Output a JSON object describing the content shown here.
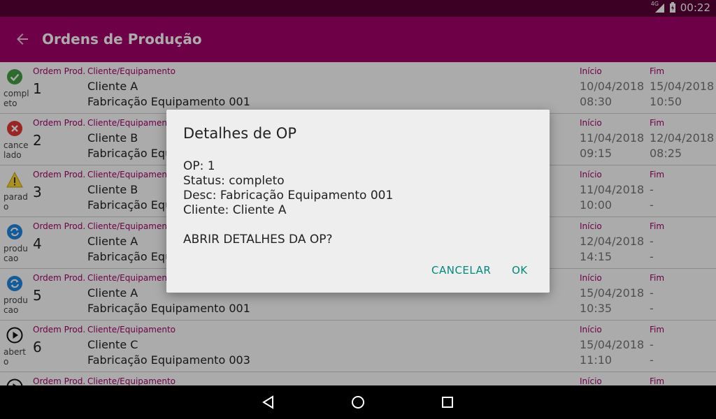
{
  "statusbar": {
    "network": "4G",
    "time": "00:22"
  },
  "appbar": {
    "title": "Ordens de Produção"
  },
  "labels": {
    "ordem": "Ordem Prod.",
    "cliente": "Cliente/Equipamento",
    "inicio": "Início",
    "fim": "Fim"
  },
  "rows": [
    {
      "icon": "check-circle-icon",
      "status": "completo",
      "op": "1",
      "cliente": "Cliente A",
      "equip": "Fabricação Equipamento 001",
      "inicio_data": "10/04/2018",
      "inicio_hora": "08:30",
      "fim_data": "15/04/2018",
      "fim_hora": "10:50"
    },
    {
      "icon": "cancel-circle-icon",
      "status": "cancelado",
      "op": "2",
      "cliente": "Cliente B",
      "equip": "Fabricação Equi",
      "inicio_data": "11/04/2018",
      "inicio_hora": "09:15",
      "fim_data": "12/04/2018",
      "fim_hora": "08:25"
    },
    {
      "icon": "warning-icon",
      "status": "parado",
      "op": "3",
      "cliente": "Cliente B",
      "equip": "Fabricação Equi",
      "inicio_data": "11/04/2018",
      "inicio_hora": "10:00",
      "fim_data": "-",
      "fim_hora": "-"
    },
    {
      "icon": "sync-icon",
      "status": "producao",
      "op": "4",
      "cliente": "Cliente A",
      "equip": "Fabricação Equi",
      "inicio_data": "12/04/2018",
      "inicio_hora": "14:15",
      "fim_data": "-",
      "fim_hora": "-"
    },
    {
      "icon": "sync-icon",
      "status": "producao",
      "op": "5",
      "cliente": "Cliente A",
      "equip": "Fabricação Equipamento 001",
      "inicio_data": "15/04/2018",
      "inicio_hora": "10:35",
      "fim_data": "-",
      "fim_hora": "-"
    },
    {
      "icon": "play-circle-icon",
      "status": "aberto",
      "op": "6",
      "cliente": "Cliente C",
      "equip": "Fabricação Equipamento 003",
      "inicio_data": "15/04/2018",
      "inicio_hora": "11:10",
      "fim_data": "-",
      "fim_hora": "-"
    },
    {
      "icon": "play-circle-icon",
      "status": "",
      "op": "",
      "cliente": "",
      "equip": "",
      "inicio_data": "",
      "inicio_hora": "",
      "fim_data": "",
      "fim_hora": ""
    }
  ],
  "dialog": {
    "title": "Detalhes de OP",
    "lines": [
      "OP: 1",
      "Status: completo",
      "Desc: Fabricação Equipamento 001",
      "Cliente: Cliente A"
    ],
    "question": "ABRIR DETALHES DA OP?",
    "cancel_label": "CANCELAR",
    "ok_label": "OK"
  },
  "colors": {
    "statusbar": "#5a0038",
    "appbar": "#a4006a",
    "accent_label": "#a4006a",
    "dialog_button": "#00897b"
  }
}
